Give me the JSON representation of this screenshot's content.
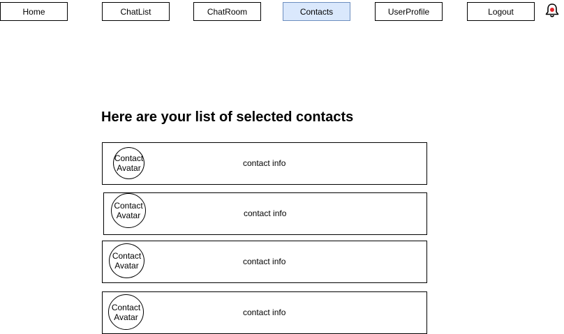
{
  "nav": {
    "home": "Home",
    "chatlist": "ChatList",
    "chatroom": "ChatRoom",
    "contacts": "Contacts",
    "userprofile": "UserProfile",
    "logout": "Logout",
    "active_item": "Contacts",
    "active_color": "#dae8fc",
    "notification_icon": "bell-icon"
  },
  "main": {
    "heading": "Here are your list of selected contacts",
    "contacts": [
      {
        "avatar_label": "Contact Avatar",
        "info": "contact info"
      },
      {
        "avatar_label": "Contact Avatar",
        "info": "contact info"
      },
      {
        "avatar_label": "Contact Avatar",
        "info": "contact info"
      },
      {
        "avatar_label": "Contact Avatar",
        "info": "contact info"
      }
    ]
  }
}
